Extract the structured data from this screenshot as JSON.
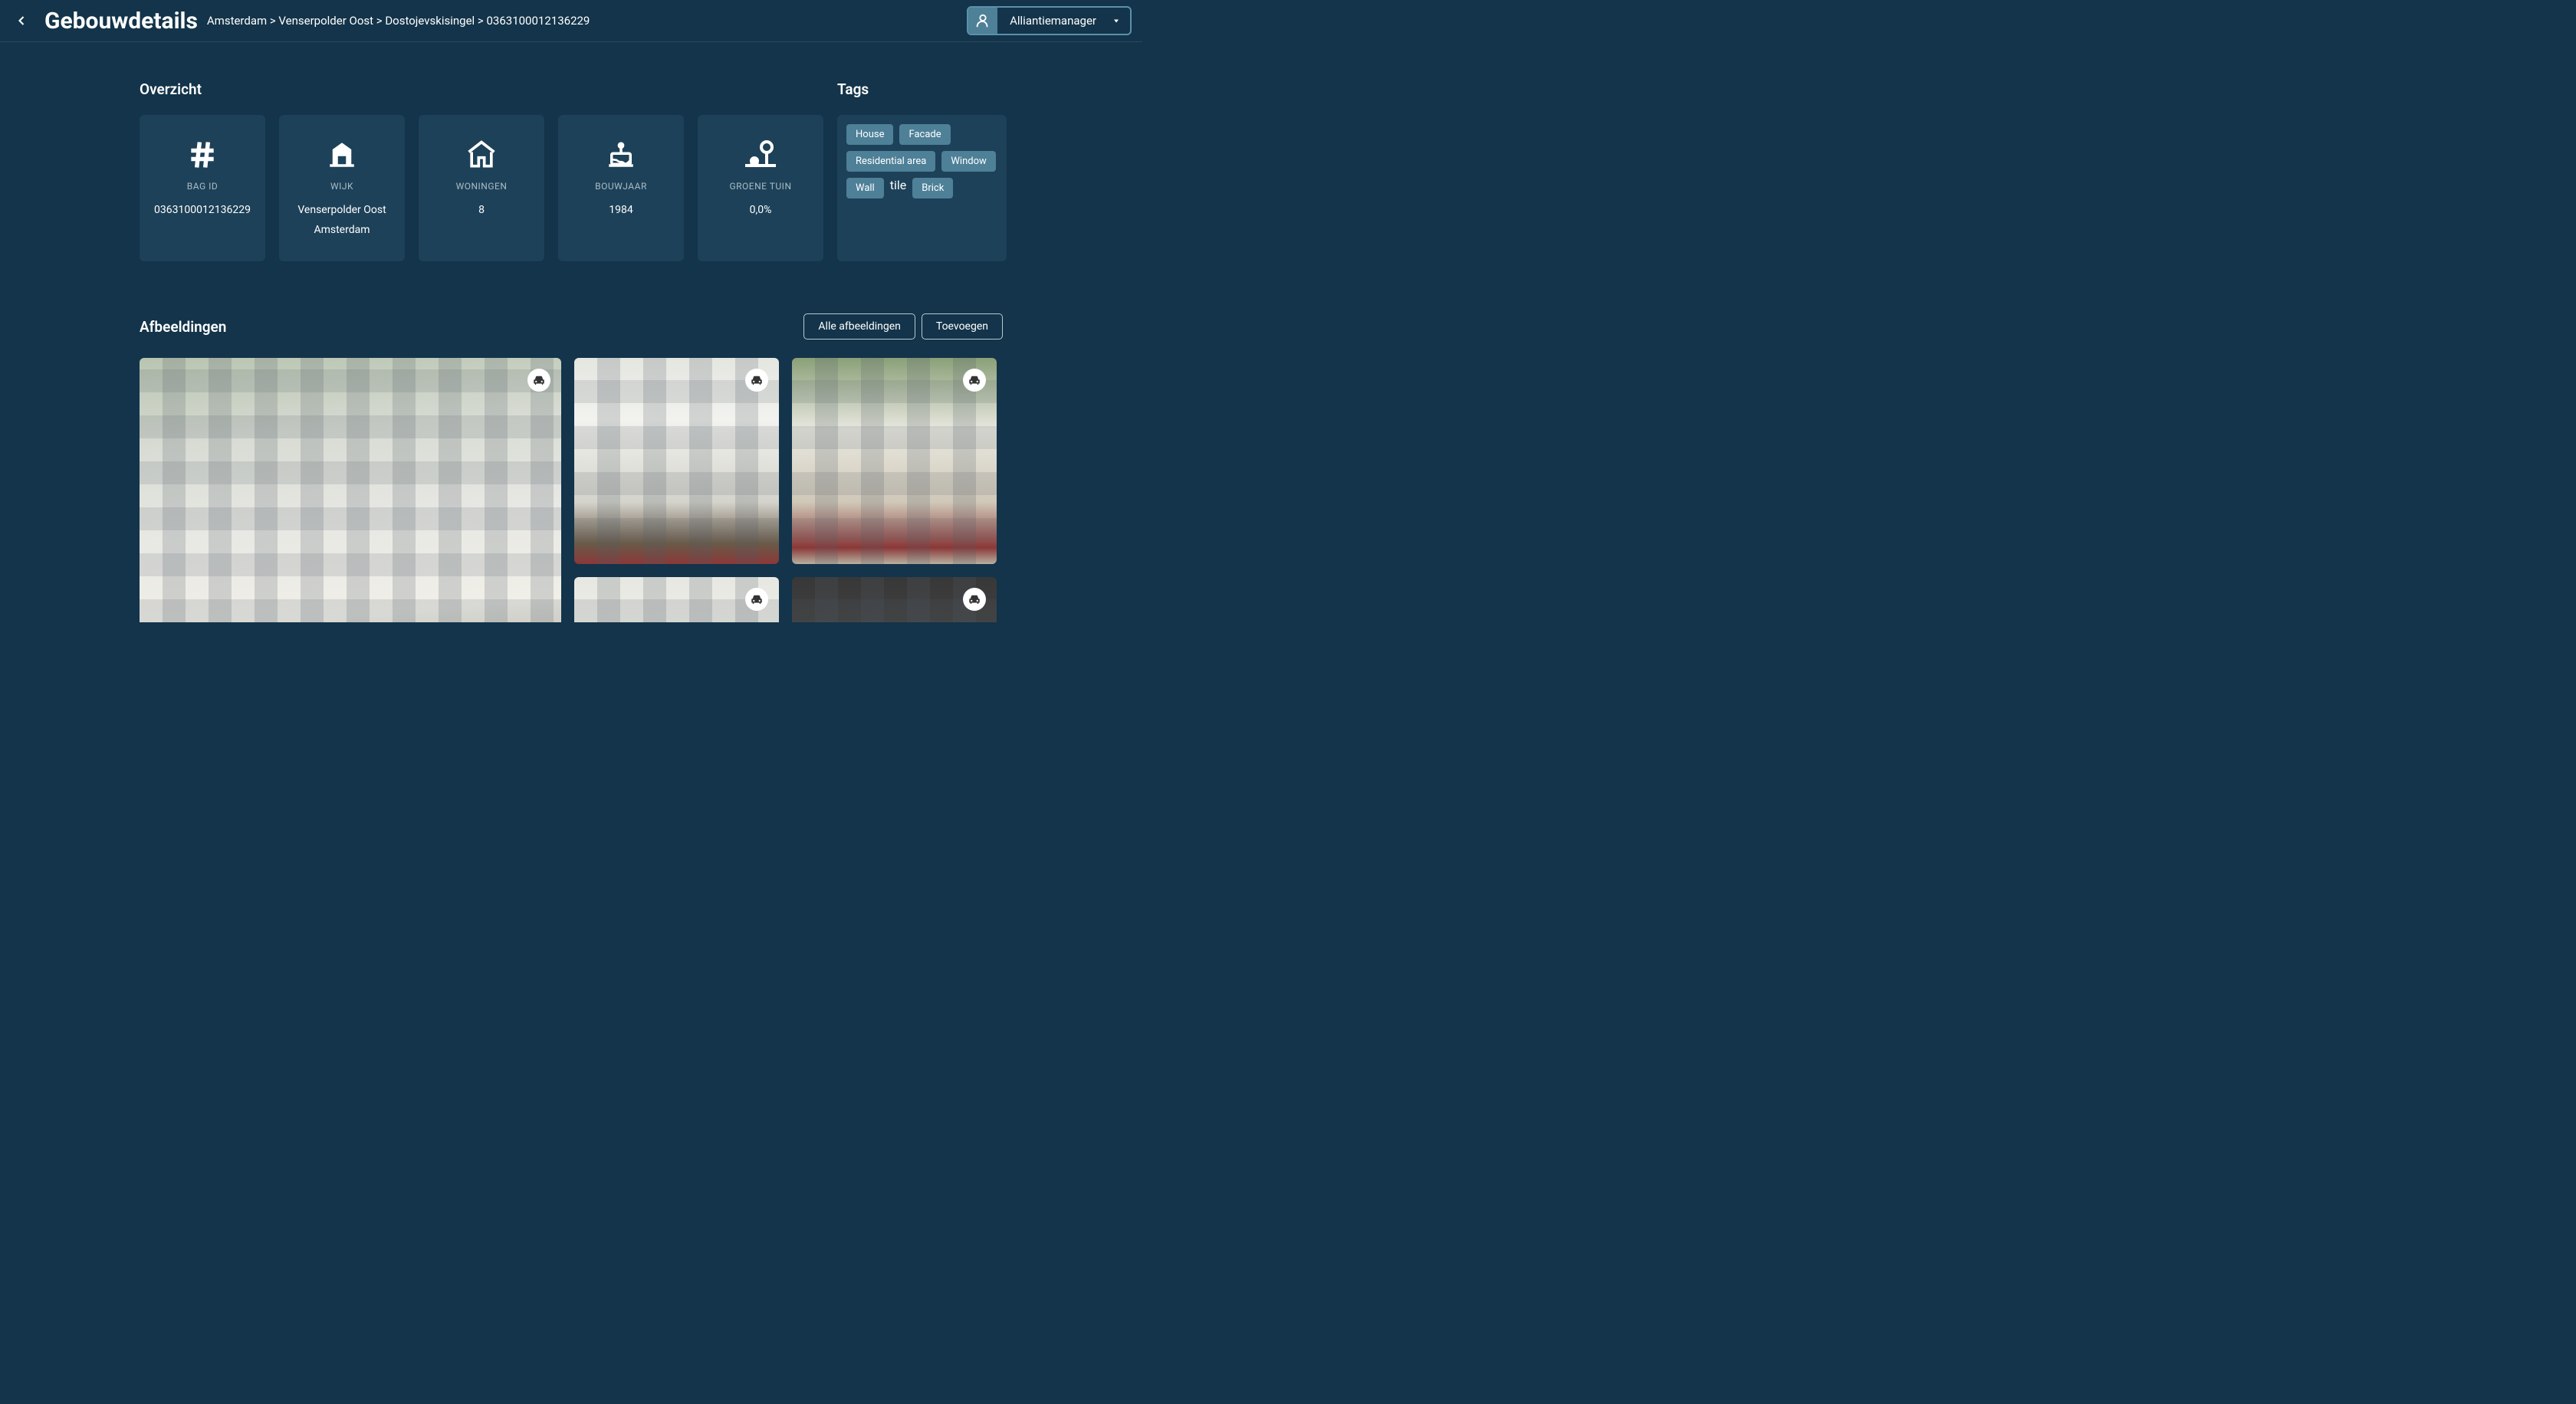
{
  "header": {
    "title": "Gebouwdetails",
    "breadcrumb": "Amsterdam > Venserpolder Oost > Dostojevskisingel > 0363100012136229",
    "user": "Alliantiemanager"
  },
  "overview": {
    "title": "Overzicht",
    "cards": [
      {
        "icon": "hash",
        "label": "BAG ID",
        "value": "0363100012136229"
      },
      {
        "icon": "building",
        "label": "WIJK",
        "value": "Venserpolder Oost",
        "value2": "Amsterdam"
      },
      {
        "icon": "house",
        "label": "WONINGEN",
        "value": "8"
      },
      {
        "icon": "cake",
        "label": "BOUWJAAR",
        "value": "1984"
      },
      {
        "icon": "nature",
        "label": "GROENE TUIN",
        "value": "0,0%"
      }
    ]
  },
  "tags": {
    "title": "Tags",
    "items": [
      "House",
      "Facade",
      "Residential area",
      "Window",
      "Wall",
      "Brick"
    ]
  },
  "images": {
    "title": "Afbeeldingen",
    "all_button": "Alle afbeeldingen",
    "add_button": "Toevoegen"
  }
}
